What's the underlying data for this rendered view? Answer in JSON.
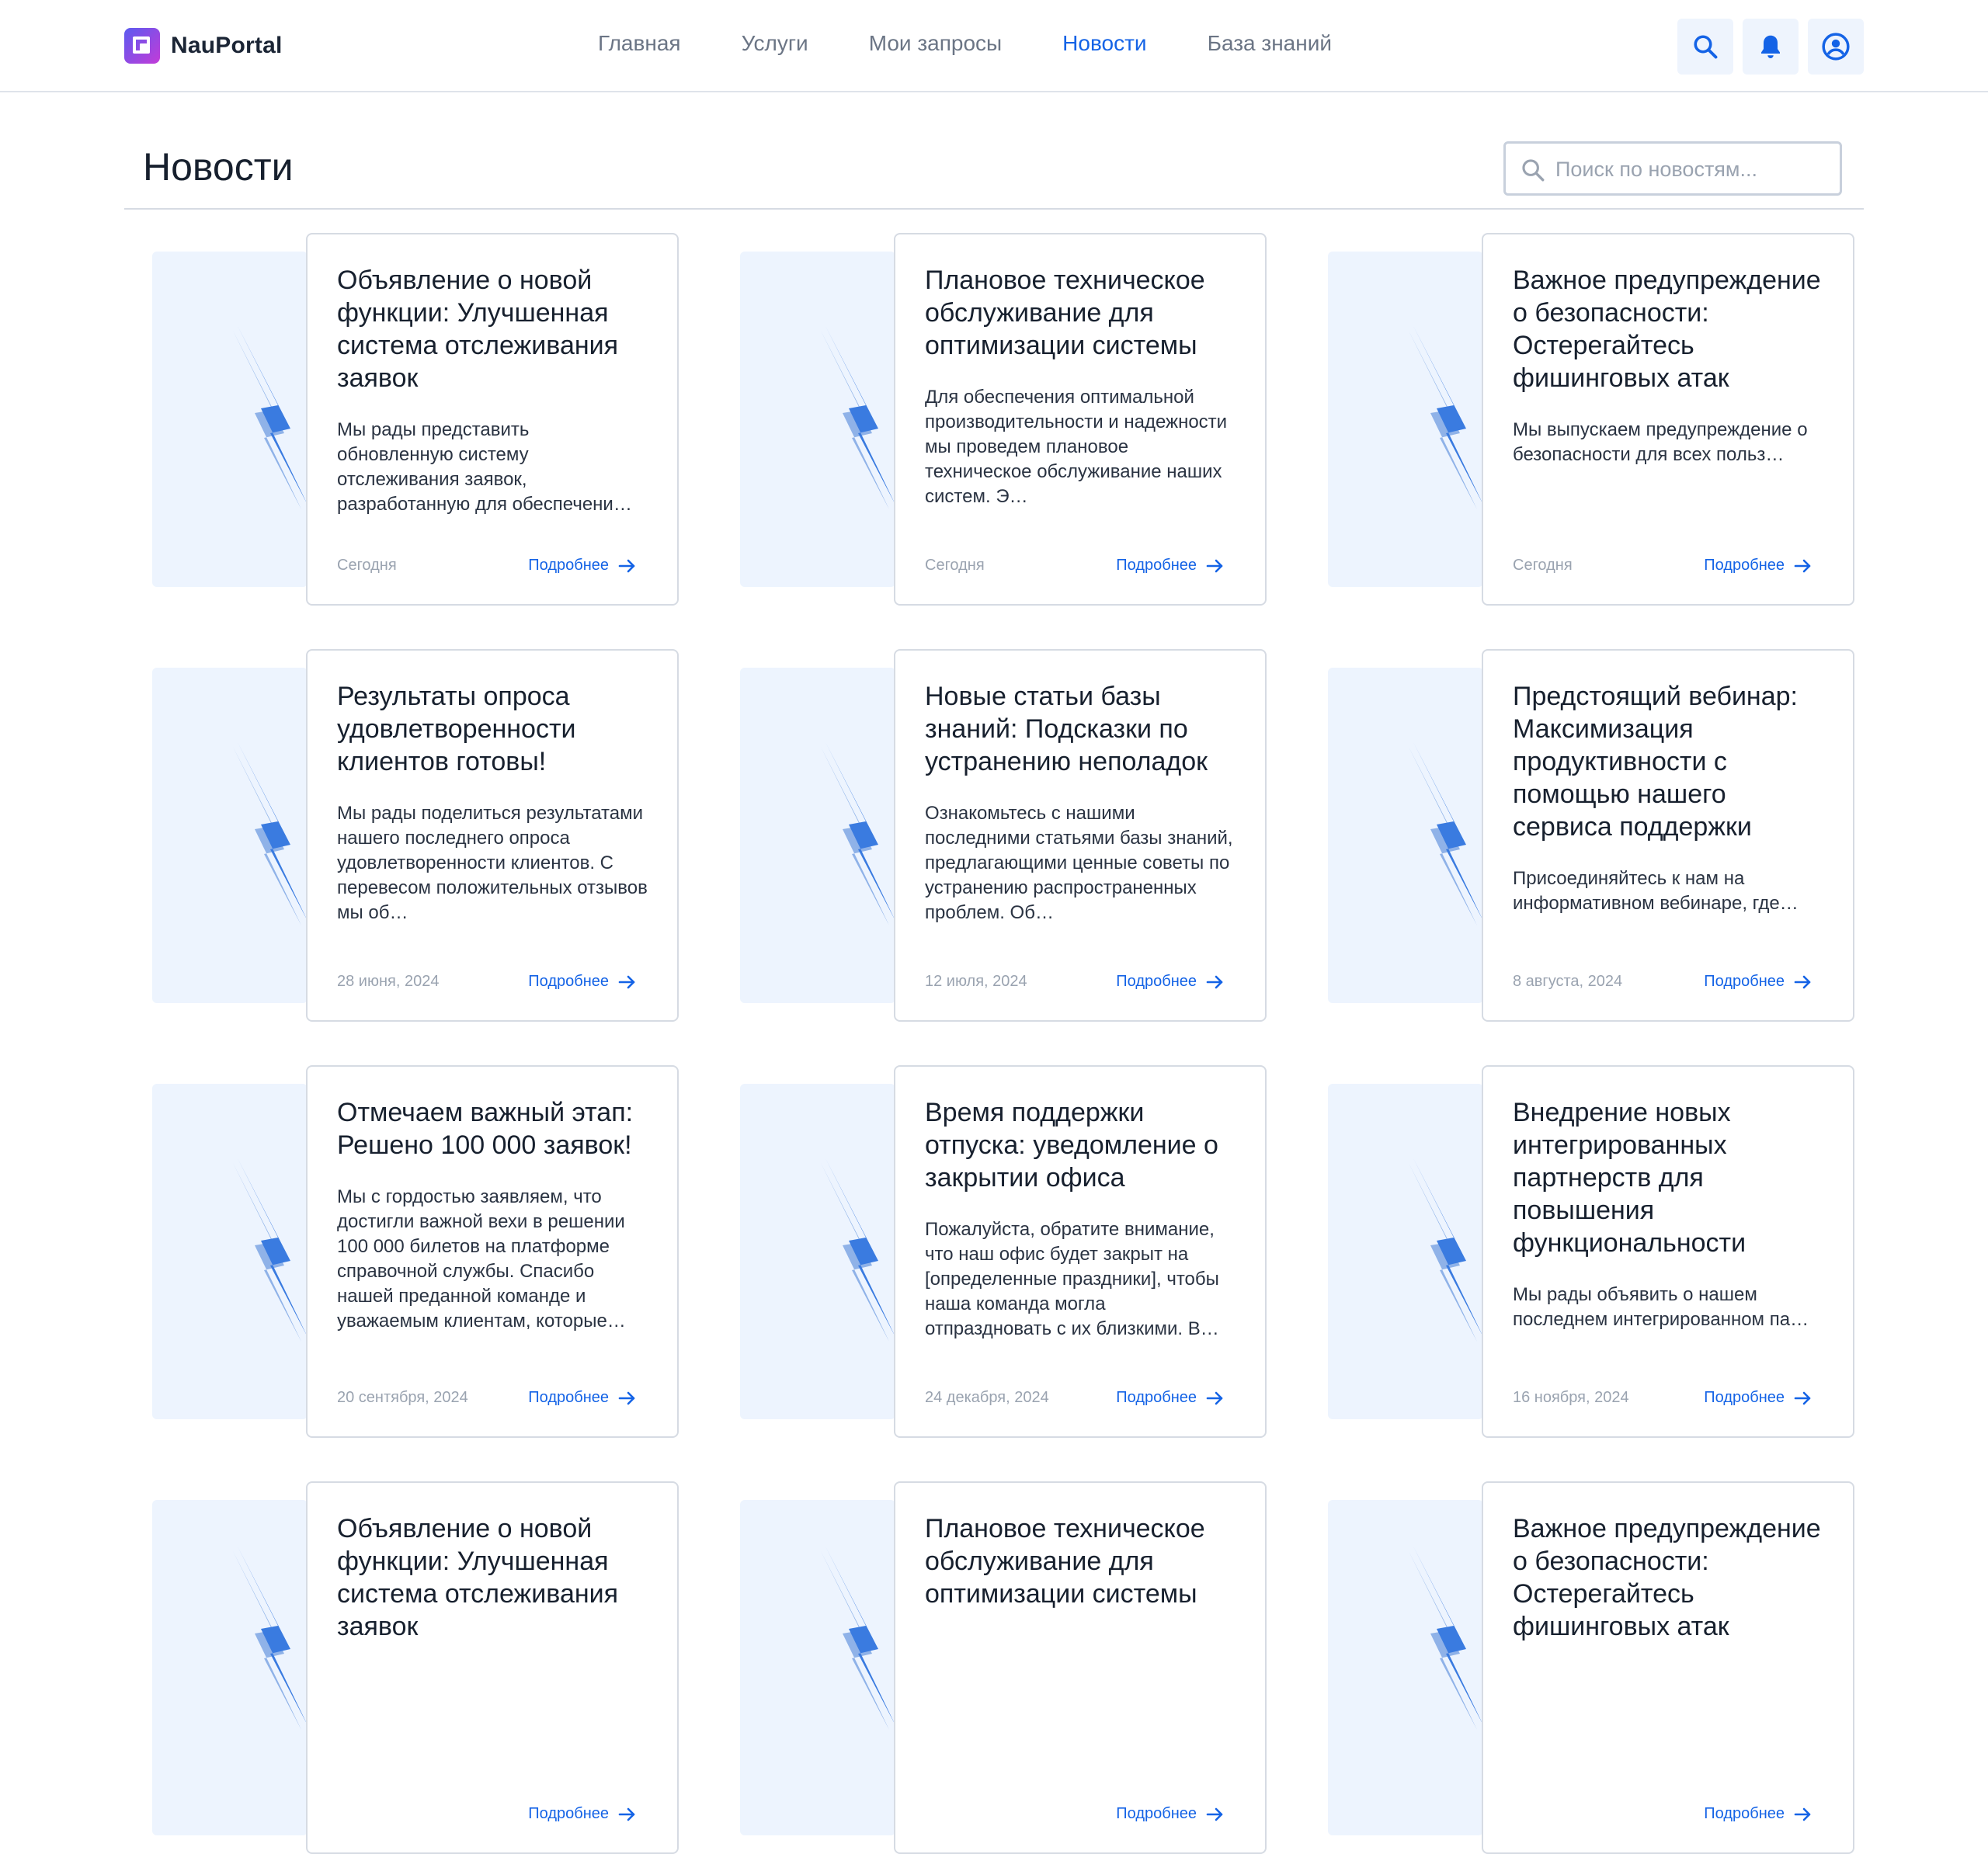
{
  "app": {
    "name": "NauPortal"
  },
  "nav": {
    "items": [
      {
        "label": "Главная",
        "active": false
      },
      {
        "label": "Услуги",
        "active": false
      },
      {
        "label": "Мои запросы",
        "active": false
      },
      {
        "label": "Новости",
        "active": true
      },
      {
        "label": "База знаний",
        "active": false
      }
    ]
  },
  "header_icons": [
    "search-icon",
    "bell-icon",
    "user-circle-icon"
  ],
  "page": {
    "title": "Новости"
  },
  "search": {
    "placeholder": "Поиск по новостям...",
    "value": ""
  },
  "colors": {
    "accent": "#1463e6",
    "card_image_bg": "#edf4fe",
    "bolt": "#3a7be0"
  },
  "link_label": "Подробнее",
  "news": [
    {
      "title": "Объявление о новой функции: Улучшенная система отслеживания заявок",
      "desc": "Мы рады представить обновленную систему отслеживания заявок, разработанную для обеспечени…",
      "date": "Сегодня"
    },
    {
      "title": "Плановое техническое обслуживание для оптимизации системы",
      "desc": "Для обеспечения оптимальной производительности и надежности мы проведем плановое техническое обслуживание наших систем. Э…",
      "date": "Сегодня"
    },
    {
      "title": "Важное предупреждение о безопасности: Остерегайтесь фишинговых атак",
      "desc": "Мы выпускаем предупреждение о безопасности для всех польз…",
      "date": "Сегодня"
    },
    {
      "title": "Результаты опроса удовлетворенности клиентов готовы!",
      "desc": "Мы рады поделиться результатами нашего последнего опроса удовлетворенности клиентов. С перевесом положительных отзывов мы об…",
      "date": "28 июня, 2024"
    },
    {
      "title": "Новые статьи базы знаний: Подсказки по устранению неполадок",
      "desc": "Ознакомьтесь с нашими последними статьями базы знаний, предлагающими ценные советы по устранению распространенных проблем. Об…",
      "date": "12 июля, 2024"
    },
    {
      "title": "Предстоящий вебинар: Максимизация продуктивности с помощью нашего сервиса поддержки",
      "desc": "Присоединяйтесь к нам на информативном вебинаре, где…",
      "date": "8 августа, 2024"
    },
    {
      "title": "Отмечаем важный этап: Решено 100 000 заявок!",
      "desc": "Мы с гордостью заявляем, что достигли важной вехи в решении 100 000 билетов на платформе справочной службы. Спасибо нашей преданной команде и уважаемым клиентам, которые…",
      "date": "20 сентября, 2024"
    },
    {
      "title": "Время поддержки отпуска: уведомление о закрытии офиса",
      "desc": "Пожалуйста, обратите внимание, что наш офис будет закрыт на [определенные праздники], чтобы наша команда могла отпраздновать с их близкими. В…",
      "date": "24 декабря, 2024"
    },
    {
      "title": "Внедрение новых интегрированных партнерств для повышения функциональности",
      "desc": "Мы рады объявить о нашем последнем интегрированном па…",
      "date": "16 ноября, 2024"
    },
    {
      "title": "Объявление о новой функции: Улучшенная система отслеживания заявок",
      "desc": "",
      "date": ""
    },
    {
      "title": "Плановое техническое обслуживание для оптимизации системы",
      "desc": "",
      "date": ""
    },
    {
      "title": "Важное предупреждение о безопасности: Остерегайтесь фишинговых атак",
      "desc": "",
      "date": ""
    }
  ]
}
